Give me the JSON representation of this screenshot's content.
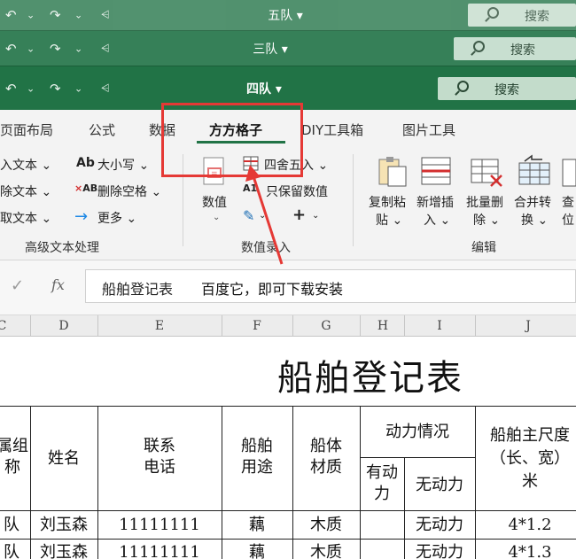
{
  "windows": [
    {
      "title": "五队 ▾",
      "search_label": "搜索"
    },
    {
      "title": "三队 ▾",
      "search_label": "搜索"
    },
    {
      "title": "四队 ▾",
      "search_label": "搜索"
    }
  ],
  "quick_access_glyphs": [
    "↶",
    "⌄",
    "↷",
    "⌄",
    "⩤"
  ],
  "tabs": [
    {
      "label": "页面布局"
    },
    {
      "label": "公式"
    },
    {
      "label": "数据"
    },
    {
      "label": "方方格子",
      "active": true
    },
    {
      "label": "DIY工具箱"
    },
    {
      "label": "图片工具"
    }
  ],
  "ribbon": {
    "left_items": [
      "入文本 ⌄",
      "除文本 ⌄",
      "取文本 ⌄"
    ],
    "case_label": "大小写 ⌄",
    "remove_space_label": "删除空格 ⌄",
    "more_label": "更多 ⌄",
    "group_text": "高级文本处理",
    "number_value_label": "数值",
    "round_label": "四舍五入 ⌄",
    "keep_number_label": "只保留数值",
    "group_number": "数值录入",
    "copy_paste_label": [
      "复制粘",
      "贴 ⌄"
    ],
    "insert_label": [
      "新增插",
      "入 ⌄"
    ],
    "batch_delete_label": [
      "批量删",
      "除 ⌄"
    ],
    "merge_label": [
      "合并转",
      "换 ⌄"
    ],
    "find_label": [
      "查",
      "位"
    ],
    "group_edit": "编辑"
  },
  "formula_bar": {
    "cancel_glyph": "✕",
    "ok_glyph": "✓",
    "fx_label": "fx",
    "value": "船舶登记表",
    "note": "百度它，即可下载安装"
  },
  "columns": [
    "C",
    "D",
    "E",
    "F",
    "G",
    "H",
    "I",
    "J"
  ],
  "sheet": {
    "title": "船舶登记表",
    "headers": {
      "group_name": [
        "属组",
        "称"
      ],
      "name": "姓名",
      "phone": [
        "联系",
        "电话"
      ],
      "usage": [
        "船舶",
        "用途"
      ],
      "material": [
        "船体",
        "材质"
      ],
      "power": "动力情况",
      "powered": [
        "有动",
        "力"
      ],
      "unpowered": "无动力",
      "size": [
        "船舶主尺度",
        "（长、宽）",
        "米"
      ]
    },
    "rows": [
      {
        "group": "队",
        "name": "刘玉森",
        "phone": "11111111",
        "usage": "藕",
        "material": "木质",
        "powered": "",
        "unpowered": "无动力",
        "size": "4*1.2"
      },
      {
        "group": "队",
        "name": "刘玉森",
        "phone": "11111111",
        "usage": "藕",
        "material": "木质",
        "powered": "",
        "unpowered": "无动力",
        "size": "4*1.3"
      }
    ]
  },
  "colors": {
    "excel_green": "#217346",
    "annotation_red": "#e53935"
  }
}
